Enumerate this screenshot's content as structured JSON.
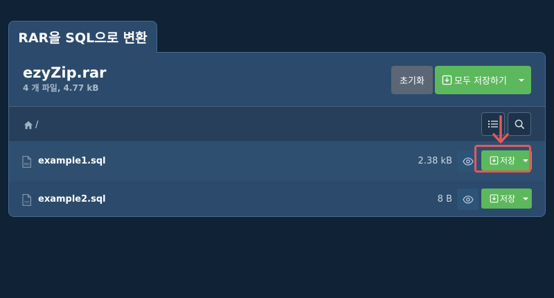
{
  "tab": {
    "title": "RAR을 SQL으로 변환"
  },
  "archive": {
    "name": "ezyZip.rar",
    "info": "4 개 파일, 4.77 kB",
    "reset_label": "초기화",
    "save_all_label": "모두 저장하기"
  },
  "breadcrumb": {
    "separator": "/"
  },
  "files": [
    {
      "name": "example1.sql",
      "size": "2.38 kB",
      "save_label": "저장",
      "icon_label": "PNG"
    },
    {
      "name": "example2.sql",
      "size": "8 B",
      "save_label": "저장",
      "icon_label": "TXT"
    }
  ],
  "colors": {
    "background": "#0f2236",
    "panel": "#2c4a6b",
    "accent_green": "#5cb85c",
    "highlight_red": "#e05b5b"
  },
  "icons": [
    "home-icon",
    "list-icon",
    "search-icon",
    "eye-icon",
    "download-icon",
    "file-icon",
    "chevron-down-icon",
    "arrow-down-icon"
  ]
}
